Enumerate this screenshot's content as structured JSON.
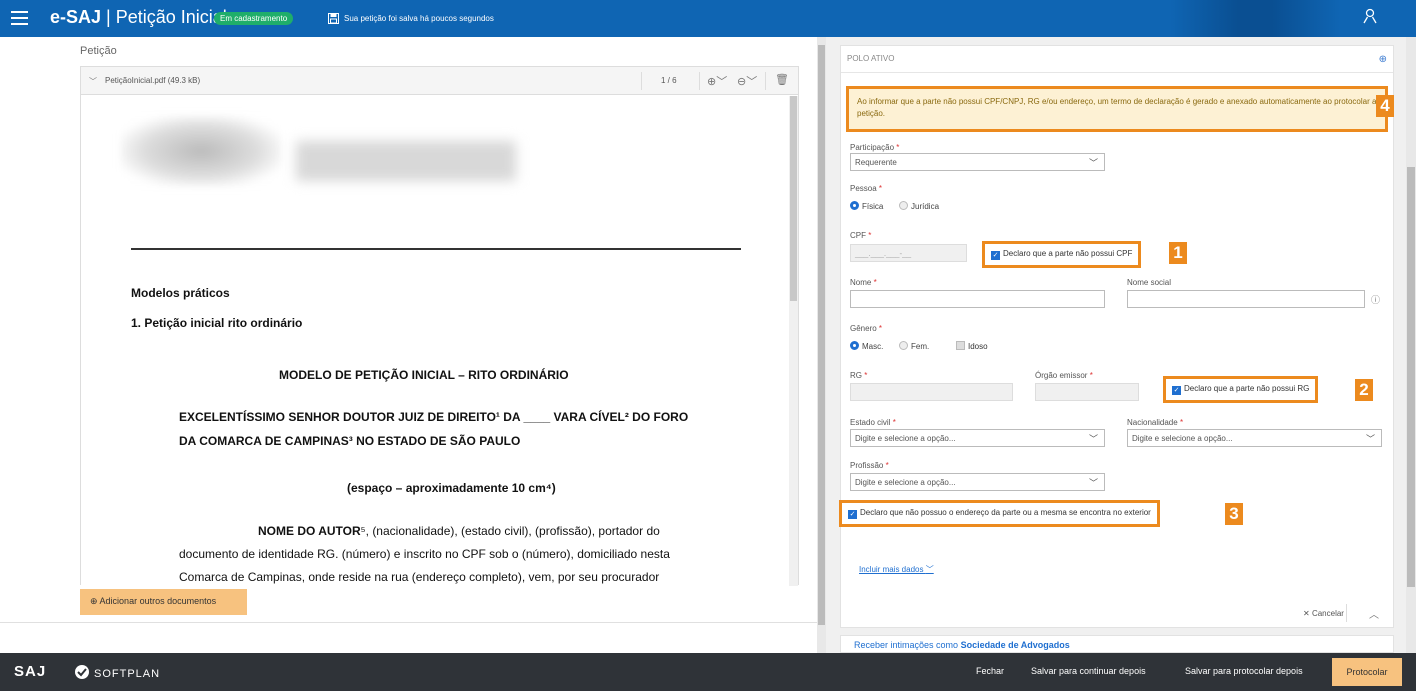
{
  "header": {
    "brand": "e-SAJ",
    "title": "Petição Inicial",
    "status": "Em cadastramento",
    "save_note": "Sua petição foi salva há poucos segundos",
    "colors": {
      "bar": "#0f65b3",
      "badge": "#1fae6a"
    }
  },
  "left": {
    "section_title": "Petição",
    "file_name": "PetiçãoInicial.pdf (49.3 kB)",
    "page_indicator": "1 / 6",
    "add_docs": "⊕ Adicionar outros documentos",
    "doc": {
      "h1": "Modelos práticos",
      "h2": "1. Petição inicial rito ordinário",
      "model_title": "MODELO DE PETIÇÃO INICIAL – RITO ORDINÁRIO",
      "addr_line1": "EXCELENTÍSSIMO SENHOR DOUTOR JUIZ DE DIREITO¹ DA ____ VARA CÍVEL² DO FORO",
      "addr_line2": "DA COMARCA DE CAMPINAS³ NO ESTADO DE SÃO PAULO",
      "space": "(espaço – aproximadamente 10 cm⁴)",
      "body1_bold": "NOME DO AUTOR",
      "body1_rest": "⁵, (nacionalidade), (estado civil), (profissão), portador do",
      "body2": "documento de identidade RG. (número) e inscrito no CPF sob o (número), domiciliado nesta",
      "body3": "Comarca de Campinas, onde reside na rua (endereço completo), vem, por seu procurador"
    }
  },
  "form": {
    "card_title": "POLO ATIVO",
    "warning": "Ao informar que a parte não possui CPF/CNPJ, RG e/ou endereço, um termo de declaração é gerado e anexado automaticamente ao protocolar a petição.",
    "participacao_label": "Participação",
    "participacao_value": "Requerente",
    "pessoa_label": "Pessoa",
    "pessoa_fisica": "Física",
    "pessoa_juridica": "Jurídica",
    "cpf_label": "CPF",
    "cpf_placeholder": "___.___.___-__",
    "cpf_declare": "Declaro que a parte não possui CPF",
    "nome_label": "Nome",
    "nome_social_label": "Nome social",
    "genero_label": "Gênero",
    "genero_masc": "Masc.",
    "genero_fem": "Fem.",
    "genero_idoso": "Idoso",
    "rg_label": "RG",
    "orgao_label": "Órgão emissor",
    "rg_declare": "Declaro que a parte não possui RG",
    "estado_civil_label": "Estado civil",
    "estado_civil_placeholder": "Digite e selecione a opção...",
    "nacionalidade_label": "Nacionalidade",
    "nacionalidade_placeholder": "Digite e selecione a opção...",
    "profissao_label": "Profissão",
    "profissao_placeholder": "Digite e selecione a opção...",
    "endereco_declare": "Declaro que não possuo o endereço da parte ou a mesma se encontra no exterior",
    "incluir_mais": "Incluir mais dados",
    "cancelar": "Cancelar",
    "receive_prefix": "Receber intimações como",
    "receive_bold": "Sociedade de Advogados",
    "markers": [
      "1",
      "2",
      "3",
      "4"
    ],
    "required_mark": "*"
  },
  "footer": {
    "saj": "SAJ",
    "softplan": "SOFTPLAN",
    "fechar": "Fechar",
    "salvar_continuar": "Salvar para continuar depois",
    "salvar_protocolar": "Salvar para protocolar depois",
    "protocolar": "Protocolar"
  }
}
